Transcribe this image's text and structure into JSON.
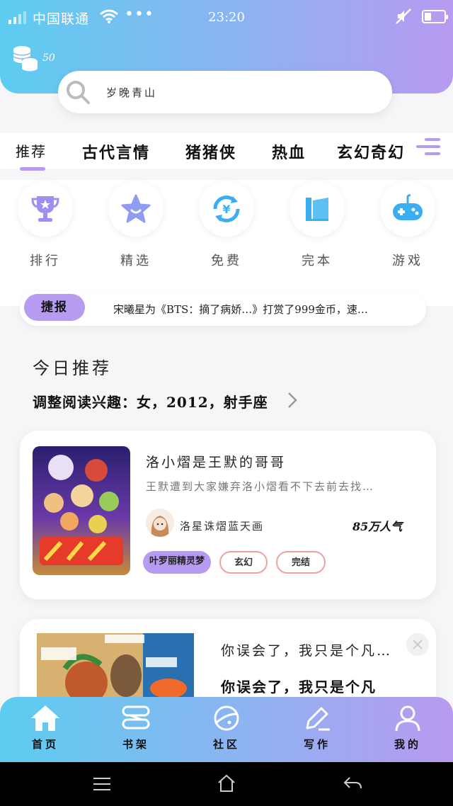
{
  "status_bar": {
    "carrier": "中国联通",
    "time": "23:20",
    "battery_level": 0.35
  },
  "wallet": {
    "coin_count": "50"
  },
  "search": {
    "placeholder": "岁晚青山"
  },
  "tabs": [
    {
      "label": "推荐",
      "active": true
    },
    {
      "label": "古代言情"
    },
    {
      "label": "猪猪侠"
    },
    {
      "label": "热血"
    },
    {
      "label": "玄幻奇幻"
    }
  ],
  "shortcuts": [
    {
      "label": "排行",
      "icon": "trophy-icon"
    },
    {
      "label": "精选",
      "icon": "star-icon"
    },
    {
      "label": "免费",
      "icon": "yuan-refresh-icon"
    },
    {
      "label": "完本",
      "icon": "book-icon"
    },
    {
      "label": "游戏",
      "icon": "gamepad-icon"
    }
  ],
  "ticker": {
    "badge": "捷报",
    "message": "宋曦星为《BTS：摘了病娇…》打赏了999金币，速…"
  },
  "recommend": {
    "title": "今日推荐",
    "subtitle": "调整阅读兴趣：女，2012，射手座"
  },
  "featured_book": {
    "title": "洛小熠是王默的哥哥",
    "description": "王默遭到大家嫌弃洛小熠看不下去前去找…",
    "author": "洛星诛熠蓝天画",
    "popularity": "85万人气",
    "tags": [
      "叶罗丽精灵梦",
      "玄幻",
      "完结"
    ]
  },
  "second_book": {
    "title": "你误会了，我只是个凡…",
    "subtitle": "你误会了，我只是个凡"
  },
  "bottom_nav": [
    {
      "label": "首页",
      "icon": "home-icon"
    },
    {
      "label": "书架",
      "icon": "bookshelf-icon"
    },
    {
      "label": "社区",
      "icon": "planet-icon"
    },
    {
      "label": "写作",
      "icon": "pen-icon"
    },
    {
      "label": "我的",
      "icon": "user-icon"
    }
  ],
  "colors": {
    "gradient_start": "#5ccdf0",
    "gradient_end": "#b89af0",
    "accent": "#b79bf0",
    "tag_outline": "#f0a0a0",
    "icon_blue": "#3aaef0",
    "icon_purple": "#9d8ff0"
  }
}
